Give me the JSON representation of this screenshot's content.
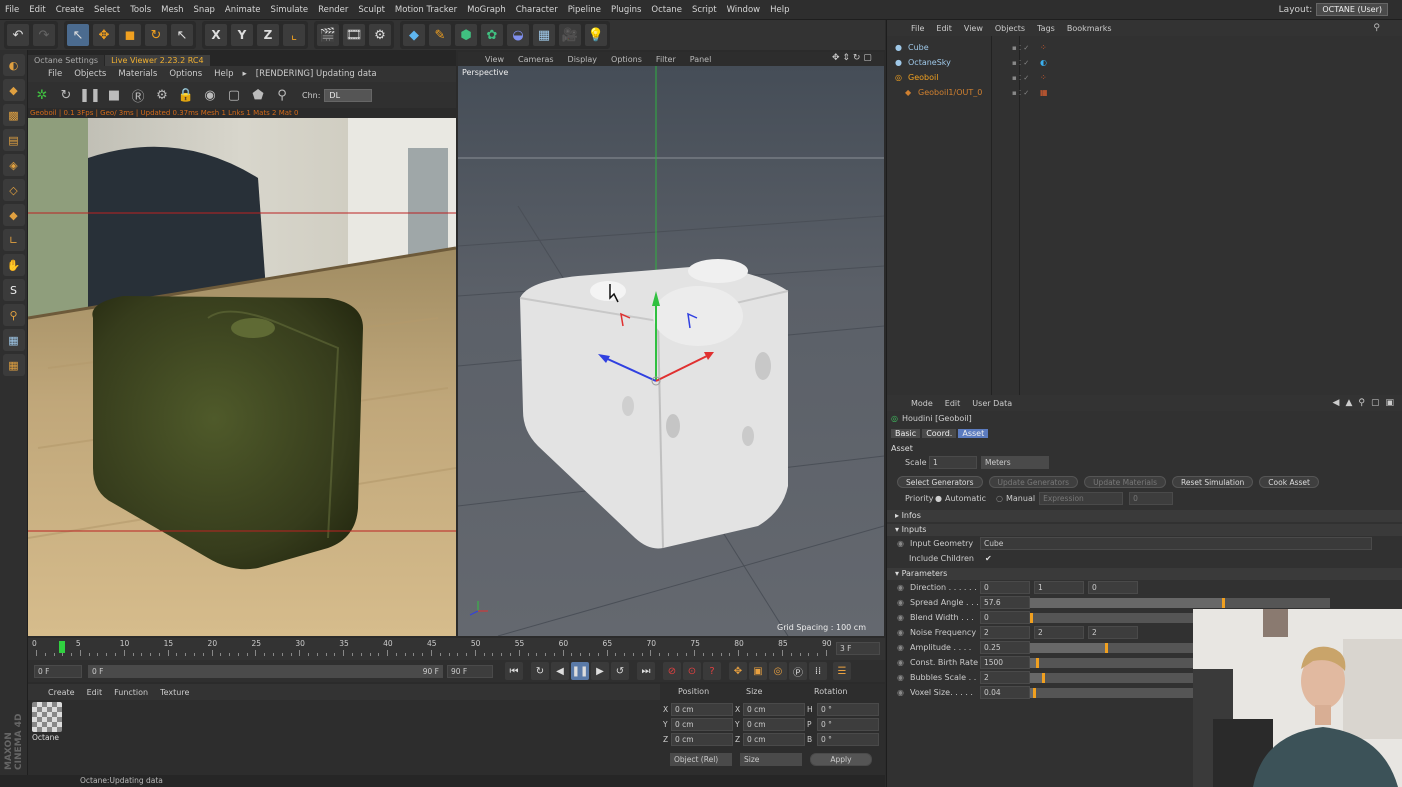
{
  "menubar": {
    "items": [
      "File",
      "Edit",
      "Create",
      "Select",
      "Tools",
      "Mesh",
      "Snap",
      "Animate",
      "Simulate",
      "Render",
      "Sculpt",
      "Motion Tracker",
      "MoGraph",
      "Character",
      "Pipeline",
      "Plugins",
      "Octane",
      "Script",
      "Window",
      "Help"
    ],
    "layout_label": "Layout:",
    "layout_value": "OCTANE (User)"
  },
  "toolbar": {
    "axis_x": "X",
    "axis_y": "Y",
    "axis_z": "Z"
  },
  "live_viewer": {
    "tabs": [
      "Octane Settings",
      "Live Viewer 2.23.2 RC4"
    ],
    "active_tab": 1,
    "menu": [
      "File",
      "Objects",
      "Materials",
      "Options",
      "Help"
    ],
    "status_menu": "[RENDERING] Updating data",
    "chn_label": "Chn:",
    "chn_value": "DL",
    "render_status": "Geoboil | 0.1 3Fps | Geo/ 3ms | Updated 0.37ms  Mesh 1  Lnks 1  Mats 2  Mat 0"
  },
  "viewport": {
    "menu": [
      "View",
      "Cameras",
      "Display",
      "Options",
      "Filter",
      "Panel"
    ],
    "name": "Perspective",
    "grid_spacing": "Grid Spacing : 100 cm"
  },
  "timeline": {
    "ticks": [
      "0",
      "5",
      "10",
      "15",
      "20",
      "25",
      "30",
      "35",
      "40",
      "45",
      "50",
      "55",
      "60",
      "65",
      "70",
      "75",
      "80",
      "85",
      "90"
    ],
    "end_field": "3 F",
    "current_frame": "0 F",
    "range_start": "0 F",
    "range_end": "90 F",
    "max_frame": "90 F",
    "playhead_frame": 3,
    "max_frame_value": 90
  },
  "material_manager": {
    "menu": [
      "Create",
      "Edit",
      "Function",
      "Texture"
    ],
    "materials": [
      {
        "name": "Octane"
      }
    ]
  },
  "coordinates": {
    "headers": [
      "Position",
      "Size",
      "Rotation"
    ],
    "rows": [
      {
        "axis": "X",
        "pos": "0 cm",
        "saxis": "X",
        "size": "0 cm",
        "raxis": "H",
        "rot": "0 °"
      },
      {
        "axis": "Y",
        "pos": "0 cm",
        "saxis": "Y",
        "size": "0 cm",
        "raxis": "P",
        "rot": "0 °"
      },
      {
        "axis": "Z",
        "pos": "0 cm",
        "saxis": "Z",
        "size": "0 cm",
        "raxis": "B",
        "rot": "0 °"
      }
    ],
    "mode_select": "Object (Rel)",
    "size_select": "Size",
    "apply_label": "Apply"
  },
  "statusbar": {
    "text": "Octane:Updating data"
  },
  "branding": {
    "vertical_logo": "MAXON CINEMA 4D"
  },
  "object_manager": {
    "menu": [
      "File",
      "Edit",
      "View",
      "Objects",
      "Tags",
      "Bookmarks"
    ],
    "objects": [
      {
        "name": "Cube",
        "color": "#9fc8e8"
      },
      {
        "name": "OctaneSky",
        "color": "#9fc8e8"
      },
      {
        "name": "Geoboil",
        "color": "#f0a020"
      },
      {
        "name": "Geoboil1/OUT_0",
        "color": "#d08030"
      }
    ]
  },
  "attributes": {
    "menu": [
      "Mode",
      "Edit",
      "User Data"
    ],
    "object_title": "Houdini [Geoboil]",
    "tabs": [
      "Basic",
      "Coord.",
      "Asset"
    ],
    "active_tab": 2,
    "section_title": "Asset",
    "scale_label": "Scale",
    "scale_value": "1",
    "scale_unit": "Meters",
    "buttons": [
      {
        "label": "Select Generators",
        "enabled": true
      },
      {
        "label": "Update Generators",
        "enabled": false
      },
      {
        "label": "Update Materials",
        "enabled": false
      },
      {
        "label": "Reset Simulation",
        "enabled": true
      },
      {
        "label": "Cook Asset",
        "enabled": true
      }
    ],
    "priority_label": "Priority",
    "priority_auto": "Automatic",
    "priority_manual": "Manual",
    "priority_expr": "Expression",
    "priority_value": "0",
    "infos_label": "Infos",
    "inputs_label": "Inputs",
    "input_geometry_label": "Input Geometry",
    "input_geometry_value": "Cube",
    "include_children_label": "Include Children",
    "parameters_label": "Parameters",
    "params": [
      {
        "label": "Direction . . . . . .",
        "values": [
          "0",
          "1",
          "0"
        ]
      },
      {
        "label": "Spread Angle . . .",
        "values": [
          "57.6"
        ],
        "fraction": 0.64
      },
      {
        "label": "Blend Width . . .",
        "values": [
          "0"
        ],
        "fraction": 0.0
      },
      {
        "label": "Noise Frequency",
        "values": [
          "2",
          "2",
          "2"
        ]
      },
      {
        "label": "Amplitude . . . .",
        "values": [
          "0.25"
        ],
        "fraction": 0.25
      },
      {
        "label": "Const. Birth Rate",
        "values": [
          "1500"
        ],
        "fraction": 0.02
      },
      {
        "label": "Bubbles Scale . .",
        "values": [
          "2"
        ],
        "fraction": 0.04
      },
      {
        "label": "Voxel Size. . . . .",
        "values": [
          "0.04"
        ],
        "fraction": 0.01
      }
    ]
  },
  "colors": {
    "accent_orange": "#f0a020",
    "selection_blue": "#4b6b8f",
    "render_status": "#d26a1a"
  }
}
